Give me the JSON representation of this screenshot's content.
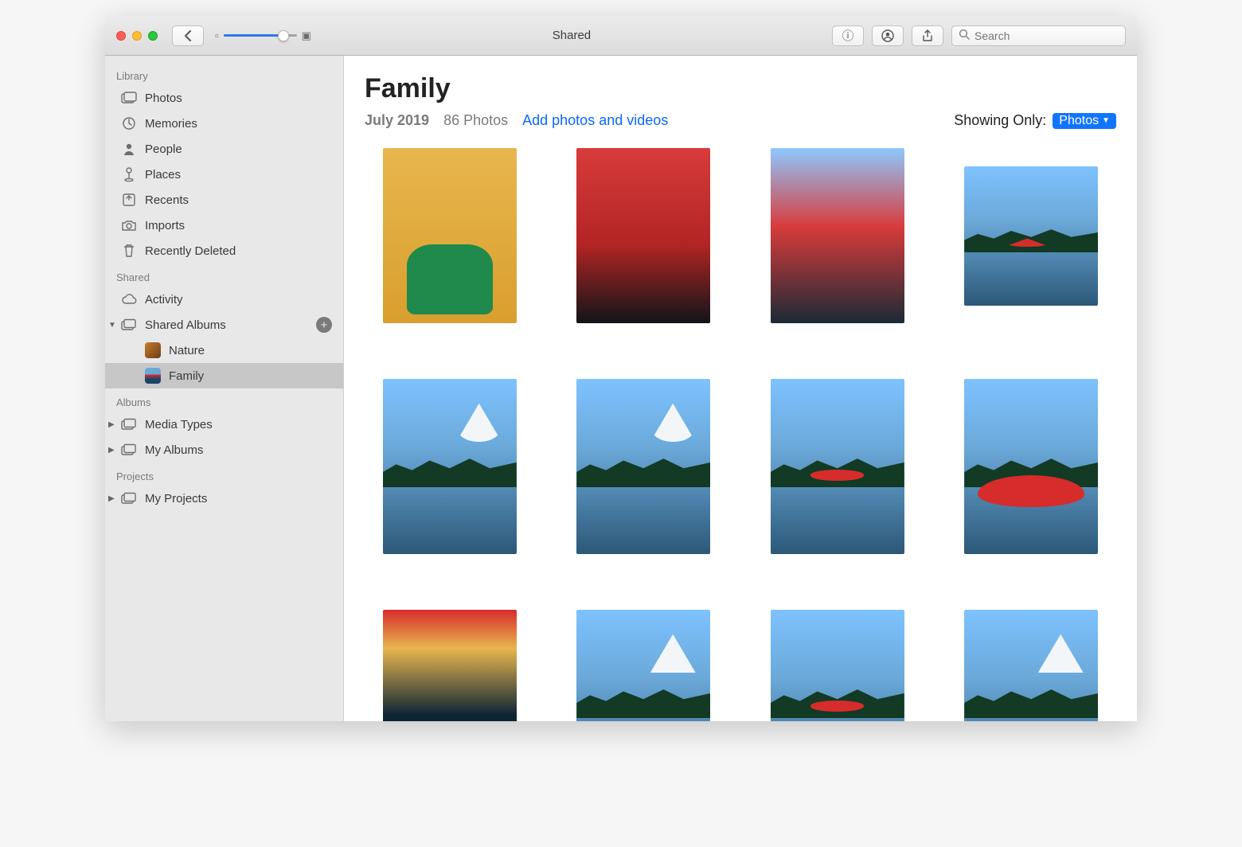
{
  "window": {
    "title": "Shared"
  },
  "toolbar": {
    "search_placeholder": "Search"
  },
  "sidebar": {
    "sections": {
      "library": {
        "label": "Library",
        "items": [
          "Photos",
          "Memories",
          "People",
          "Places",
          "Recents",
          "Imports",
          "Recently Deleted"
        ]
      },
      "shared": {
        "label": "Shared",
        "activity": "Activity",
        "shared_albums": "Shared Albums",
        "albums": [
          "Nature",
          "Family"
        ],
        "selected": "Family"
      },
      "albums": {
        "label": "Albums",
        "items": [
          "Media Types",
          "My Albums"
        ]
      },
      "projects": {
        "label": "Projects",
        "items": [
          "My Projects"
        ]
      }
    }
  },
  "main": {
    "album_title": "Family",
    "date": "July 2019",
    "count": "86 Photos",
    "add_link": "Add photos and videos",
    "showing_label": "Showing Only:",
    "showing_value": "Photos"
  }
}
